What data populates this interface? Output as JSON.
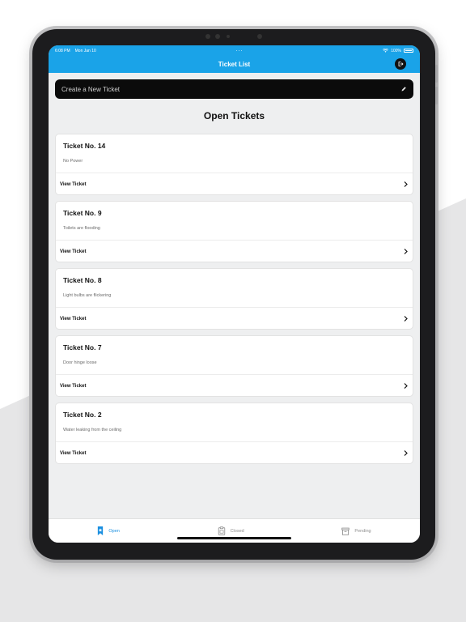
{
  "status": {
    "time": "6:08 PM",
    "date": "Mon Jan 10",
    "dots": "...",
    "battery": "100%"
  },
  "nav": {
    "title": "Ticket List"
  },
  "create": {
    "label": "Create a New Ticket"
  },
  "section": {
    "title": "Open Tickets"
  },
  "tickets": [
    {
      "title": "Ticket No. 14",
      "description": "No Power",
      "action": "View Ticket"
    },
    {
      "title": "Ticket No. 9",
      "description": "Toilets are flooding",
      "action": "View Ticket"
    },
    {
      "title": "Ticket No. 8",
      "description": "Light bulbs are flickering",
      "action": "View Ticket"
    },
    {
      "title": "Ticket No. 7",
      "description": "Door hinge loose",
      "action": "View Ticket"
    },
    {
      "title": "Ticket No. 2",
      "description": "Water leaking from the ceiling",
      "action": "View Ticket"
    }
  ],
  "tabs": [
    {
      "label": "Open",
      "icon": "bookmark-icon",
      "active": true
    },
    {
      "label": "Closed",
      "icon": "clipboard-icon",
      "active": false
    },
    {
      "label": "Pending",
      "icon": "archive-icon",
      "active": false
    }
  ],
  "colors": {
    "accent": "#1aa3e8",
    "activeTab": "#1a8fe0"
  }
}
